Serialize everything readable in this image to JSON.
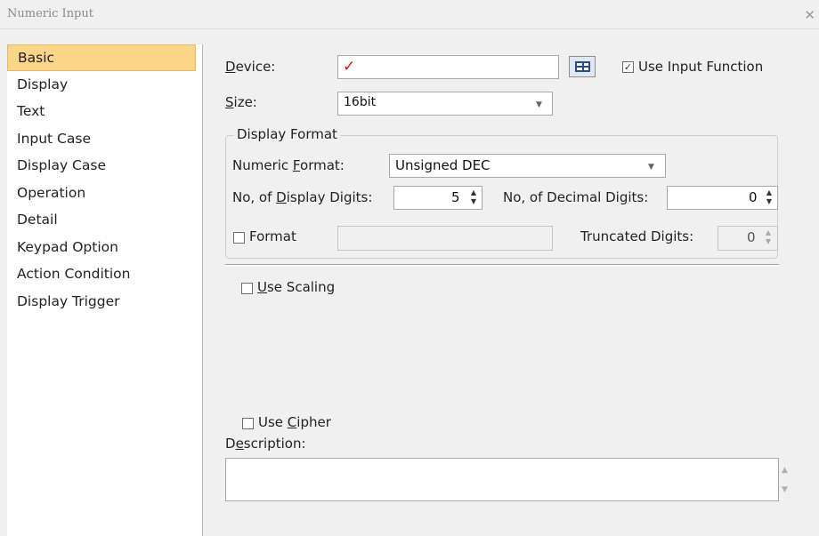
{
  "window": {
    "title": "Numeric Input",
    "close_glyph": "✕"
  },
  "sidebar": {
    "items": [
      {
        "label": "Basic",
        "selected": true
      },
      {
        "label": "Display"
      },
      {
        "label": "Text"
      },
      {
        "label": "Input Case"
      },
      {
        "label": "Display Case"
      },
      {
        "label": "Operation"
      },
      {
        "label": "Detail"
      },
      {
        "label": "Keypad Option"
      },
      {
        "label": "Action Condition"
      },
      {
        "label": "Display Trigger"
      }
    ]
  },
  "device": {
    "label_mnemonic": "D",
    "label_rest": "evice:",
    "value": "✓",
    "value_color": "#e01010"
  },
  "use_input_function": {
    "label": "Use Input Function",
    "checked": true
  },
  "size": {
    "label_mnemonic": "S",
    "label_rest": "ize:",
    "value": "16bit"
  },
  "display_format": {
    "legend": "Display Format",
    "numeric_format": {
      "label_pre": "Numeric ",
      "label_mnemonic": "F",
      "label_post": "ormat:",
      "value": "Unsigned DEC"
    },
    "display_digits": {
      "label_pre": "No, of ",
      "label_mnemonic": "D",
      "label_post": "isplay Digits:",
      "value": "5"
    },
    "decimal_digits": {
      "label_pre": "No, of Decimal Di",
      "label_mnemonic": "g",
      "label_post": "its:",
      "value": "0"
    },
    "format": {
      "label": "Format",
      "checked": false,
      "value": ""
    },
    "truncated_digits": {
      "label": "Truncated Digits:",
      "value": "0"
    }
  },
  "use_scaling": {
    "label_mnemonic": "U",
    "label_rest": "se Scaling",
    "checked": false
  },
  "use_cipher": {
    "label_pre": "Use ",
    "label_mnemonic": "C",
    "label_post": "ipher",
    "checked": false
  },
  "description": {
    "label_pre": "D",
    "label_mnemonic": "e",
    "label_post": "scription:",
    "value": ""
  }
}
